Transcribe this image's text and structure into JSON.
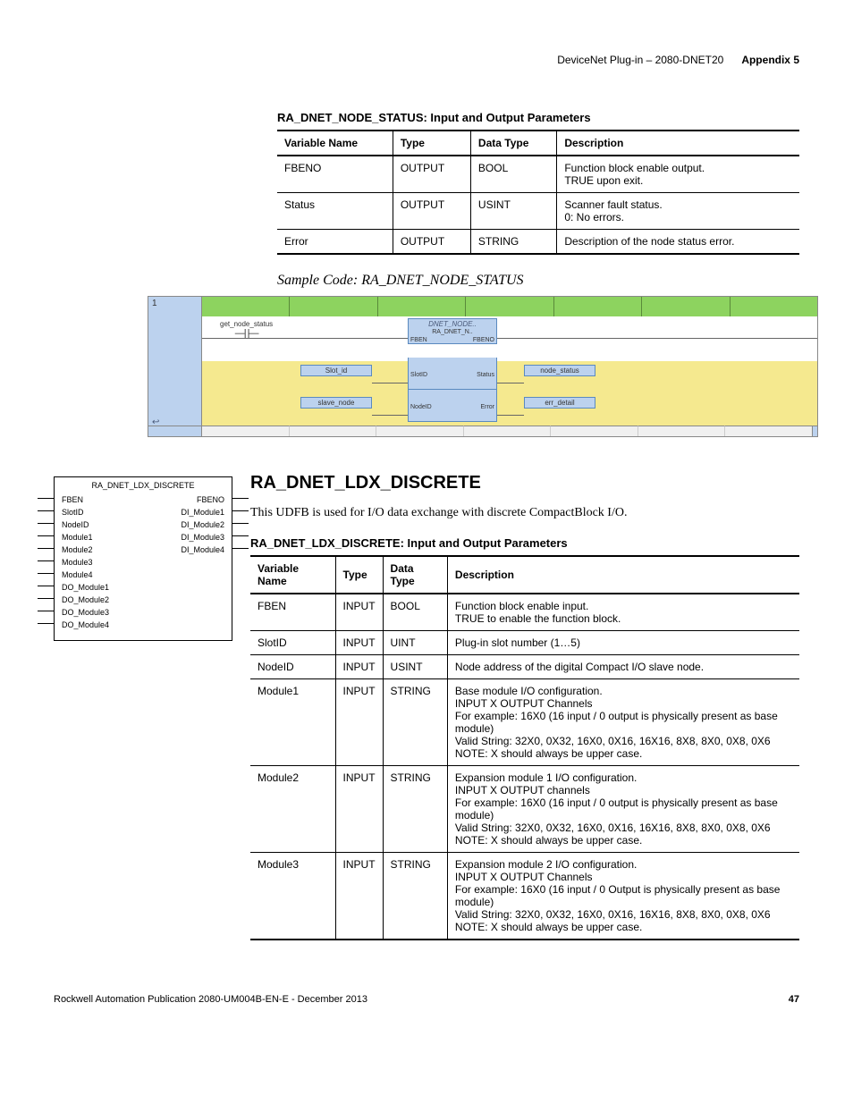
{
  "header": {
    "left": "DeviceNet Plug-in – 2080-DNET20",
    "right": "Appendix 5"
  },
  "table1": {
    "title": "RA_DNET_NODE_STATUS: Input and Output Parameters",
    "headers": [
      "Variable Name",
      "Type",
      "Data Type",
      "Description"
    ],
    "rows": [
      [
        "FBENO",
        "OUTPUT",
        "BOOL",
        "Function block enable output.\nTRUE upon exit."
      ],
      [
        "Status",
        "OUTPUT",
        "USINT",
        "Scanner fault status.\n0: No errors."
      ],
      [
        "Error",
        "OUTPUT",
        "STRING",
        "Description of the node status error."
      ]
    ]
  },
  "sample_caption": "Sample Code: RA_DNET_NODE_STATUS",
  "ladder": {
    "rung_num": "1",
    "contact_label": "get_node_status",
    "fb_title": "DNET_NODE..",
    "fb_sub": "RA_DNET_N..",
    "fb_pins_top": {
      "l": "FBEN",
      "r": "FBENO"
    },
    "fb_pins": [
      {
        "l": "SlotID",
        "r": "Status"
      },
      {
        "l": "NodeID",
        "r": "Error"
      }
    ],
    "vars": {
      "slot_id": "Slot_id",
      "slave_node": "slave_node",
      "node_status": "node_status",
      "err_detail": "err_detail"
    }
  },
  "udfb": {
    "title": "RA_DNET_LDX_DISCRETE",
    "left_pins": [
      "FBEN",
      "SlotID",
      "NodeID",
      "Module1",
      "Module2",
      "Module3",
      "Module4",
      "DO_Module1",
      "DO_Module2",
      "DO_Module3",
      "DO_Module4"
    ],
    "right_pins": [
      "FBENO",
      "DI_Module1",
      "DI_Module2",
      "DI_Module3",
      "DI_Module4"
    ]
  },
  "section2": {
    "heading": "RA_DNET_LDX_DISCRETE",
    "body": "This UDFB is used for I/O data exchange with discrete CompactBlock I/O."
  },
  "table2": {
    "title": "RA_DNET_LDX_DISCRETE: Input and Output Parameters",
    "headers": [
      "Variable Name",
      "Type",
      "Data Type",
      "Description"
    ],
    "rows": [
      [
        "FBEN",
        "INPUT",
        "BOOL",
        "Function block enable input.\nTRUE to enable the function block."
      ],
      [
        "SlotID",
        "INPUT",
        "UINT",
        "Plug-in slot number (1…5)"
      ],
      [
        "NodeID",
        "INPUT",
        "USINT",
        "Node address of the digital Compact I/O slave node."
      ],
      [
        "Module1",
        "INPUT",
        "STRING",
        "Base module I/O configuration.\nINPUT X OUTPUT Channels\nFor example: 16X0 (16 input / 0 output is physically present as base module)\nValid String:  32X0, 0X32, 16X0, 0X16, 16X16, 8X8, 8X0, 0X8, 0X6\nNOTE: X should always be upper case."
      ],
      [
        "Module2",
        "INPUT",
        "STRING",
        "Expansion module 1 I/O configuration.\nINPUT X OUTPUT channels\nFor example: 16X0 (16 input / 0 output is physically present as base module)\nValid String:  32X0, 0X32, 16X0, 0X16, 16X16, 8X8, 8X0, 0X8, 0X6\nNOTE: X should always be upper case."
      ],
      [
        "Module3",
        "INPUT",
        "STRING",
        "Expansion module 2 I/O configuration.\nINPUT X OUTPUT Channels\nFor example: 16X0 (16 input / 0 Output is physically present as base module)\nValid String:  32X0, 0X32, 16X0, 0X16, 16X16, 8X8, 8X0, 0X8, 0X6\nNOTE: X should always be upper case."
      ]
    ]
  },
  "footer": {
    "left": "Rockwell Automation Publication 2080-UM004B-EN-E - December 2013",
    "right": "47"
  }
}
